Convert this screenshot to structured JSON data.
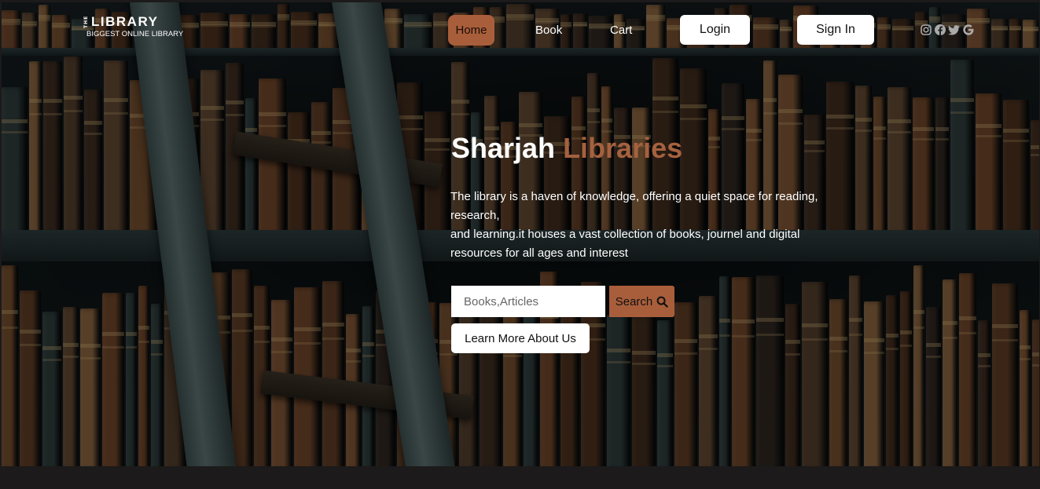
{
  "brand": {
    "the": "THE",
    "name": "LIBRARY",
    "tagline": "BIGGEST ONLINE LIBRARY"
  },
  "nav": {
    "home": "Home",
    "book": "Book",
    "cart": "Cart",
    "login": "Login",
    "signin": "Sign In"
  },
  "socials": [
    "instagram-icon",
    "facebook-icon",
    "twitter-icon",
    "google-icon"
  ],
  "hero": {
    "title_main": "Sharjah",
    "title_accent": "Libraries",
    "desc_line1": "The library is a haven of knowledge, offering a quiet space for reading, research,",
    "desc_line2": "and learning.it houses a vast collection of books, journel and digital resources for all ages and interest",
    "search_placeholder": "Books,Articles",
    "search_label": "Search",
    "learn_more": "Learn More About Us"
  },
  "colors": {
    "accent": "#a95e3b",
    "accent_text": "#a5613f",
    "footer_bar": "#1c1a1a"
  }
}
